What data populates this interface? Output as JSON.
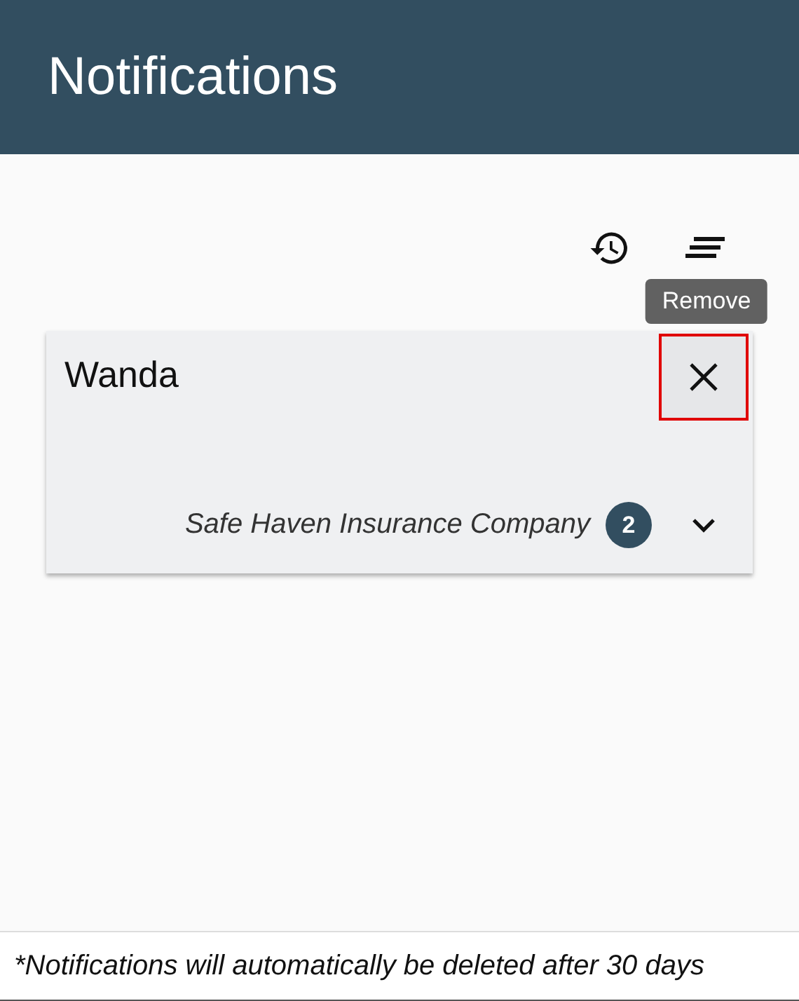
{
  "header": {
    "title": "Notifications"
  },
  "toolbar": {
    "tooltip": "Remove"
  },
  "card": {
    "name": "Wanda",
    "close_highlighted": true,
    "company": "Safe Haven Insurance Company",
    "count": "2",
    "expanded": false
  },
  "footer": {
    "note": "*Notifications will automatically be deleted after 30 days"
  }
}
